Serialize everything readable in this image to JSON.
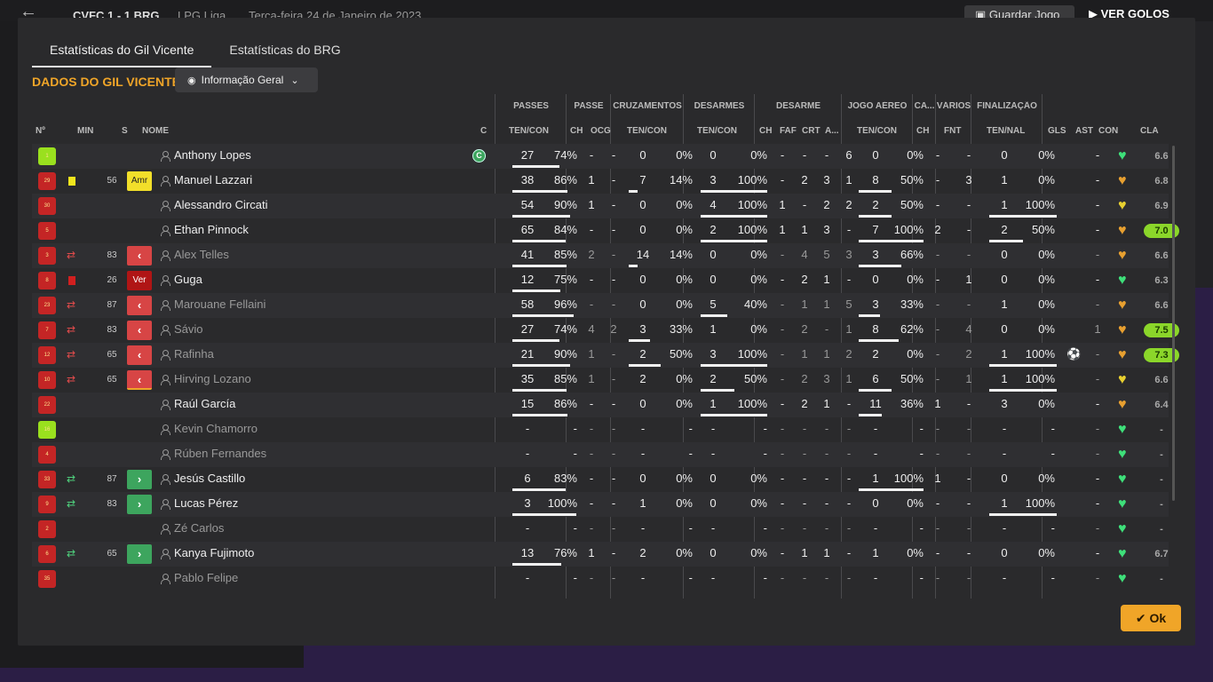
{
  "background": {
    "score": "CVFC  1 - 1  BRG",
    "competition": "LPG Liga",
    "date": "Terça-feira 24 de Janeiro de 2023",
    "save_label": "Guardar Jogo",
    "goals_label": "VER GOLOS"
  },
  "tabs": [
    "Estatísticas do Gil Vicente",
    "Estatísticas do BRG"
  ],
  "section_title": "DADOS DO GIL VICENTE",
  "dropdown": {
    "label": "Informação Geral",
    "icon": "eye-icon"
  },
  "groups": {
    "passes": "PASSES",
    "passe": "PASSE",
    "cruz": "CRUZAMENTOS",
    "desarmes": "DESARMES",
    "desarme": "DESARME",
    "aereo": "JOGO AÉREO",
    "ca": "CA...",
    "varios": "VÁRIOS",
    "final": "FINALIZAÇÃO"
  },
  "headers": {
    "no": "Nº",
    "min": "MIN",
    "s": "S",
    "nome": "NOME",
    "c": "C",
    "pass_tc": "TEN/CON",
    "pass_ch": "CH",
    "pass_ocg": "OCG",
    "cruz_tc": "TEN/CON",
    "des_tc": "TEN/CON",
    "d_ch": "CH",
    "d_faf": "FAF",
    "d_crt": "CRT",
    "d_a": "A...",
    "aer_tc": "TEN/CON",
    "ca_ch": "CH",
    "var_fnt": "FNT",
    "fin_tn": "TEN/NAL",
    "gls": "GLS",
    "ast": "AST",
    "con": "CON",
    "cla": "CLA"
  },
  "ok_label": "Ok",
  "rows": [
    {
      "no": "1",
      "kit": "gk",
      "card": "",
      "min": "",
      "sub": "",
      "name": "Anthony Lopes",
      "dim": false,
      "cap": "C",
      "pt": "27",
      "pp": "74%",
      "pb": 74,
      "ch": "-",
      "ocg": "-",
      "ct": "0",
      "cp": "0%",
      "cb": 0,
      "dt": "0",
      "dp": "0%",
      "db": 0,
      "dch": "-",
      "faf": "-",
      "crt": "-",
      "da": "6",
      "at": "0",
      "ap": "0%",
      "ab": 0,
      "cach": "-",
      "fnt": "-",
      "ft": "0",
      "fp": "0%",
      "fb": 0,
      "gls": "",
      "ast": "-",
      "con": "green",
      "cla": "6.6",
      "hi": false,
      "ball": false
    },
    {
      "no": "29",
      "kit": "red",
      "card": "y",
      "min": "56",
      "sub": "Amr",
      "name": "Manuel Lazzari",
      "dim": false,
      "cap": "",
      "pt": "38",
      "pp": "86%",
      "pb": 86,
      "ch": "1",
      "ocg": "-",
      "ct": "7",
      "cp": "14%",
      "cb": 14,
      "dt": "3",
      "dp": "100%",
      "db": 100,
      "dch": "-",
      "faf": "2",
      "crt": "3",
      "da": "1",
      "at": "8",
      "ap": "50%",
      "ab": 50,
      "cach": "-",
      "fnt": "3",
      "ft": "1",
      "fp": "0%",
      "fb": 0,
      "gls": "",
      "ast": "-",
      "con": "orange",
      "cla": "6.8",
      "hi": false,
      "ball": false
    },
    {
      "no": "30",
      "kit": "red",
      "card": "",
      "min": "",
      "sub": "",
      "name": "Alessandro Circati",
      "dim": false,
      "cap": "",
      "pt": "54",
      "pp": "90%",
      "pb": 90,
      "ch": "1",
      "ocg": "-",
      "ct": "0",
      "cp": "0%",
      "cb": 0,
      "dt": "4",
      "dp": "100%",
      "db": 100,
      "dch": "1",
      "faf": "-",
      "crt": "2",
      "da": "2",
      "at": "2",
      "ap": "50%",
      "ab": 50,
      "cach": "-",
      "fnt": "-",
      "ft": "1",
      "fp": "100%",
      "fb": 100,
      "gls": "",
      "ast": "-",
      "con": "yellow",
      "cla": "6.9",
      "hi": false,
      "ball": false
    },
    {
      "no": "5",
      "kit": "red",
      "card": "",
      "min": "",
      "sub": "",
      "name": "Ethan Pinnock",
      "dim": false,
      "cap": "",
      "pt": "65",
      "pp": "84%",
      "pb": 84,
      "ch": "-",
      "ocg": "-",
      "ct": "0",
      "cp": "0%",
      "cb": 0,
      "dt": "2",
      "dp": "100%",
      "db": 100,
      "dch": "1",
      "faf": "1",
      "crt": "3",
      "da": "-",
      "at": "7",
      "ap": "100%",
      "ab": 100,
      "cach": "2",
      "fnt": "-",
      "ft": "2",
      "fp": "50%",
      "fb": 50,
      "gls": "",
      "ast": "-",
      "con": "orange",
      "cla": "7.0",
      "hi": true,
      "ball": false
    },
    {
      "no": "3",
      "kit": "red",
      "card": "o",
      "min": "83",
      "sub": "out",
      "name": "Alex Telles",
      "dim": true,
      "cap": "",
      "pt": "41",
      "pp": "85%",
      "pb": 85,
      "ch": "2",
      "ocg": "-",
      "ct": "14",
      "cp": "14%",
      "cb": 14,
      "dt": "0",
      "dp": "0%",
      "db": 0,
      "dch": "-",
      "faf": "4",
      "crt": "5",
      "da": "3",
      "at": "3",
      "ap": "66%",
      "ab": 66,
      "cach": "-",
      "fnt": "-",
      "ft": "0",
      "fp": "0%",
      "fb": 0,
      "gls": "",
      "ast": "-",
      "con": "orange",
      "cla": "6.6",
      "hi": false,
      "ball": false
    },
    {
      "no": "8",
      "kit": "red",
      "card": "r",
      "min": "26",
      "sub": "Ver",
      "name": "Guga",
      "dim": false,
      "cap": "",
      "pt": "12",
      "pp": "75%",
      "pb": 75,
      "ch": "-",
      "ocg": "-",
      "ct": "0",
      "cp": "0%",
      "cb": 0,
      "dt": "0",
      "dp": "0%",
      "db": 0,
      "dch": "-",
      "faf": "2",
      "crt": "1",
      "da": "-",
      "at": "0",
      "ap": "0%",
      "ab": 0,
      "cach": "-",
      "fnt": "1",
      "ft": "0",
      "fp": "0%",
      "fb": 0,
      "gls": "",
      "ast": "-",
      "con": "green",
      "cla": "6.3",
      "hi": false,
      "ball": false
    },
    {
      "no": "23",
      "kit": "red",
      "card": "o",
      "min": "87",
      "sub": "out",
      "name": "Marouane Fellaini",
      "dim": true,
      "cap": "",
      "pt": "58",
      "pp": "96%",
      "pb": 96,
      "ch": "-",
      "ocg": "-",
      "ct": "0",
      "cp": "0%",
      "cb": 0,
      "dt": "5",
      "dp": "40%",
      "db": 40,
      "dch": "-",
      "faf": "1",
      "crt": "1",
      "da": "5",
      "at": "3",
      "ap": "33%",
      "ab": 33,
      "cach": "-",
      "fnt": "-",
      "ft": "1",
      "fp": "0%",
      "fb": 0,
      "gls": "",
      "ast": "-",
      "con": "orange",
      "cla": "6.6",
      "hi": false,
      "ball": false
    },
    {
      "no": "7",
      "kit": "red",
      "card": "o",
      "min": "83",
      "sub": "out",
      "name": "Sávio",
      "dim": true,
      "cap": "",
      "pt": "27",
      "pp": "74%",
      "pb": 74,
      "ch": "4",
      "ocg": "2",
      "ct": "3",
      "cp": "33%",
      "cb": 33,
      "dt": "1",
      "dp": "0%",
      "db": 0,
      "dch": "-",
      "faf": "2",
      "crt": "-",
      "da": "1",
      "at": "8",
      "ap": "62%",
      "ab": 62,
      "cach": "-",
      "fnt": "4",
      "ft": "0",
      "fp": "0%",
      "fb": 0,
      "gls": "",
      "ast": "1",
      "con": "orange",
      "cla": "7.5",
      "hi": true,
      "ball": false
    },
    {
      "no": "12",
      "kit": "red",
      "card": "o",
      "min": "65",
      "sub": "out",
      "name": "Rafinha",
      "dim": true,
      "cap": "",
      "pt": "21",
      "pp": "90%",
      "pb": 90,
      "ch": "1",
      "ocg": "-",
      "ct": "2",
      "cp": "50%",
      "cb": 50,
      "dt": "3",
      "dp": "100%",
      "db": 100,
      "dch": "-",
      "faf": "1",
      "crt": "1",
      "da": "2",
      "at": "2",
      "ap": "0%",
      "ab": 0,
      "cach": "-",
      "fnt": "2",
      "ft": "1",
      "fp": "100%",
      "fb": 100,
      "gls": "",
      "ast": "-",
      "con": "orange",
      "cla": "7.3",
      "hi": true,
      "ball": true
    },
    {
      "no": "10",
      "kit": "red",
      "card": "o",
      "min": "65",
      "sub": "out-rd",
      "name": "Hirving Lozano",
      "dim": true,
      "cap": "",
      "pt": "35",
      "pp": "85%",
      "pb": 85,
      "ch": "1",
      "ocg": "-",
      "ct": "2",
      "cp": "0%",
      "cb": 0,
      "dt": "2",
      "dp": "50%",
      "db": 50,
      "dch": "-",
      "faf": "2",
      "crt": "3",
      "da": "1",
      "at": "6",
      "ap": "50%",
      "ab": 50,
      "cach": "-",
      "fnt": "1",
      "ft": "1",
      "fp": "100%",
      "fb": 100,
      "gls": "",
      "ast": "-",
      "con": "yellow",
      "cla": "6.6",
      "hi": false,
      "ball": false
    },
    {
      "no": "22",
      "kit": "red",
      "card": "",
      "min": "",
      "sub": "",
      "name": "Raúl García",
      "dim": false,
      "cap": "",
      "pt": "15",
      "pp": "86%",
      "pb": 86,
      "ch": "-",
      "ocg": "-",
      "ct": "0",
      "cp": "0%",
      "cb": 0,
      "dt": "1",
      "dp": "100%",
      "db": 100,
      "dch": "-",
      "faf": "2",
      "crt": "1",
      "da": "-",
      "at": "11",
      "ap": "36%",
      "ab": 36,
      "cach": "1",
      "fnt": "-",
      "ft": "3",
      "fp": "0%",
      "fb": 0,
      "gls": "",
      "ast": "-",
      "con": "orange",
      "cla": "6.4",
      "hi": false,
      "ball": false
    },
    {
      "no": "16",
      "kit": "gk",
      "card": "",
      "min": "",
      "sub": "",
      "name": "Kevin Chamorro",
      "dim": true,
      "cap": "",
      "pt": "-",
      "pp": "-",
      "pb": 0,
      "ch": "-",
      "ocg": "-",
      "ct": "-",
      "cp": "-",
      "cb": 0,
      "dt": "-",
      "dp": "-",
      "db": 0,
      "dch": "-",
      "faf": "-",
      "crt": "-",
      "da": "-",
      "at": "-",
      "ap": "-",
      "ab": 0,
      "cach": "-",
      "fnt": "-",
      "ft": "-",
      "fp": "-",
      "fb": 0,
      "gls": "",
      "ast": "-",
      "con": "green",
      "cla": "-",
      "hi": false,
      "ball": false
    },
    {
      "no": "4",
      "kit": "red",
      "card": "",
      "min": "",
      "sub": "",
      "name": "Rúben Fernandes",
      "dim": true,
      "cap": "",
      "pt": "-",
      "pp": "-",
      "pb": 0,
      "ch": "-",
      "ocg": "-",
      "ct": "-",
      "cp": "-",
      "cb": 0,
      "dt": "-",
      "dp": "-",
      "db": 0,
      "dch": "-",
      "faf": "-",
      "crt": "-",
      "da": "-",
      "at": "-",
      "ap": "-",
      "ab": 0,
      "cach": "-",
      "fnt": "-",
      "ft": "-",
      "fp": "-",
      "fb": 0,
      "gls": "",
      "ast": "-",
      "con": "green",
      "cla": "-",
      "hi": false,
      "ball": false
    },
    {
      "no": "33",
      "kit": "red",
      "card": "i",
      "min": "87",
      "sub": "in",
      "name": "Jesús Castillo",
      "dim": false,
      "cap": "",
      "pt": "6",
      "pp": "83%",
      "pb": 83,
      "ch": "-",
      "ocg": "-",
      "ct": "0",
      "cp": "0%",
      "cb": 0,
      "dt": "0",
      "dp": "0%",
      "db": 0,
      "dch": "-",
      "faf": "-",
      "crt": "-",
      "da": "-",
      "at": "1",
      "ap": "100%",
      "ab": 100,
      "cach": "1",
      "fnt": "-",
      "ft": "0",
      "fp": "0%",
      "fb": 0,
      "gls": "",
      "ast": "-",
      "con": "green",
      "cla": "-",
      "hi": false,
      "ball": false
    },
    {
      "no": "9",
      "kit": "red",
      "card": "i",
      "min": "83",
      "sub": "in",
      "name": "Lucas Pérez",
      "dim": false,
      "cap": "",
      "pt": "3",
      "pp": "100%",
      "pb": 100,
      "ch": "-",
      "ocg": "-",
      "ct": "1",
      "cp": "0%",
      "cb": 0,
      "dt": "0",
      "dp": "0%",
      "db": 0,
      "dch": "-",
      "faf": "-",
      "crt": "-",
      "da": "-",
      "at": "0",
      "ap": "0%",
      "ab": 0,
      "cach": "-",
      "fnt": "-",
      "ft": "1",
      "fp": "100%",
      "fb": 100,
      "gls": "",
      "ast": "-",
      "con": "green",
      "cla": "-",
      "hi": false,
      "ball": false
    },
    {
      "no": "2",
      "kit": "red",
      "card": "",
      "min": "",
      "sub": "",
      "name": "Zé Carlos",
      "dim": true,
      "cap": "",
      "pt": "-",
      "pp": "-",
      "pb": 0,
      "ch": "-",
      "ocg": "-",
      "ct": "-",
      "cp": "-",
      "cb": 0,
      "dt": "-",
      "dp": "-",
      "db": 0,
      "dch": "-",
      "faf": "-",
      "crt": "-",
      "da": "-",
      "at": "-",
      "ap": "-",
      "ab": 0,
      "cach": "-",
      "fnt": "-",
      "ft": "-",
      "fp": "-",
      "fb": 0,
      "gls": "",
      "ast": "-",
      "con": "green",
      "cla": "-",
      "hi": false,
      "ball": false
    },
    {
      "no": "6",
      "kit": "red",
      "card": "i",
      "min": "65",
      "sub": "in",
      "name": "Kanya Fujimoto",
      "dim": false,
      "cap": "",
      "pt": "13",
      "pp": "76%",
      "pb": 76,
      "ch": "1",
      "ocg": "-",
      "ct": "2",
      "cp": "0%",
      "cb": 0,
      "dt": "0",
      "dp": "0%",
      "db": 0,
      "dch": "-",
      "faf": "1",
      "crt": "1",
      "da": "-",
      "at": "1",
      "ap": "0%",
      "ab": 0,
      "cach": "-",
      "fnt": "-",
      "ft": "0",
      "fp": "0%",
      "fb": 0,
      "gls": "",
      "ast": "-",
      "con": "green",
      "cla": "6.7",
      "hi": false,
      "ball": false
    },
    {
      "no": "35",
      "kit": "red",
      "card": "",
      "min": "",
      "sub": "",
      "name": "Pablo Felipe",
      "dim": true,
      "cap": "",
      "pt": "-",
      "pp": "-",
      "pb": 0,
      "ch": "-",
      "ocg": "-",
      "ct": "-",
      "cp": "-",
      "cb": 0,
      "dt": "-",
      "dp": "-",
      "db": 0,
      "dch": "-",
      "faf": "-",
      "crt": "-",
      "da": "-",
      "at": "-",
      "ap": "-",
      "ab": 0,
      "cach": "-",
      "fnt": "-",
      "ft": "-",
      "fp": "-",
      "fb": 0,
      "gls": "",
      "ast": "-",
      "con": "green",
      "cla": "-",
      "hi": false,
      "ball": false
    }
  ],
  "colors": {
    "accent": "#f0a528",
    "sub_out": "#d74545",
    "sub_in": "#3da55e",
    "heart_green": "#3ee07a",
    "heart_orange": "#e8a030",
    "heart_yellow": "#e8d030",
    "rating_high": "#8bd62a"
  }
}
